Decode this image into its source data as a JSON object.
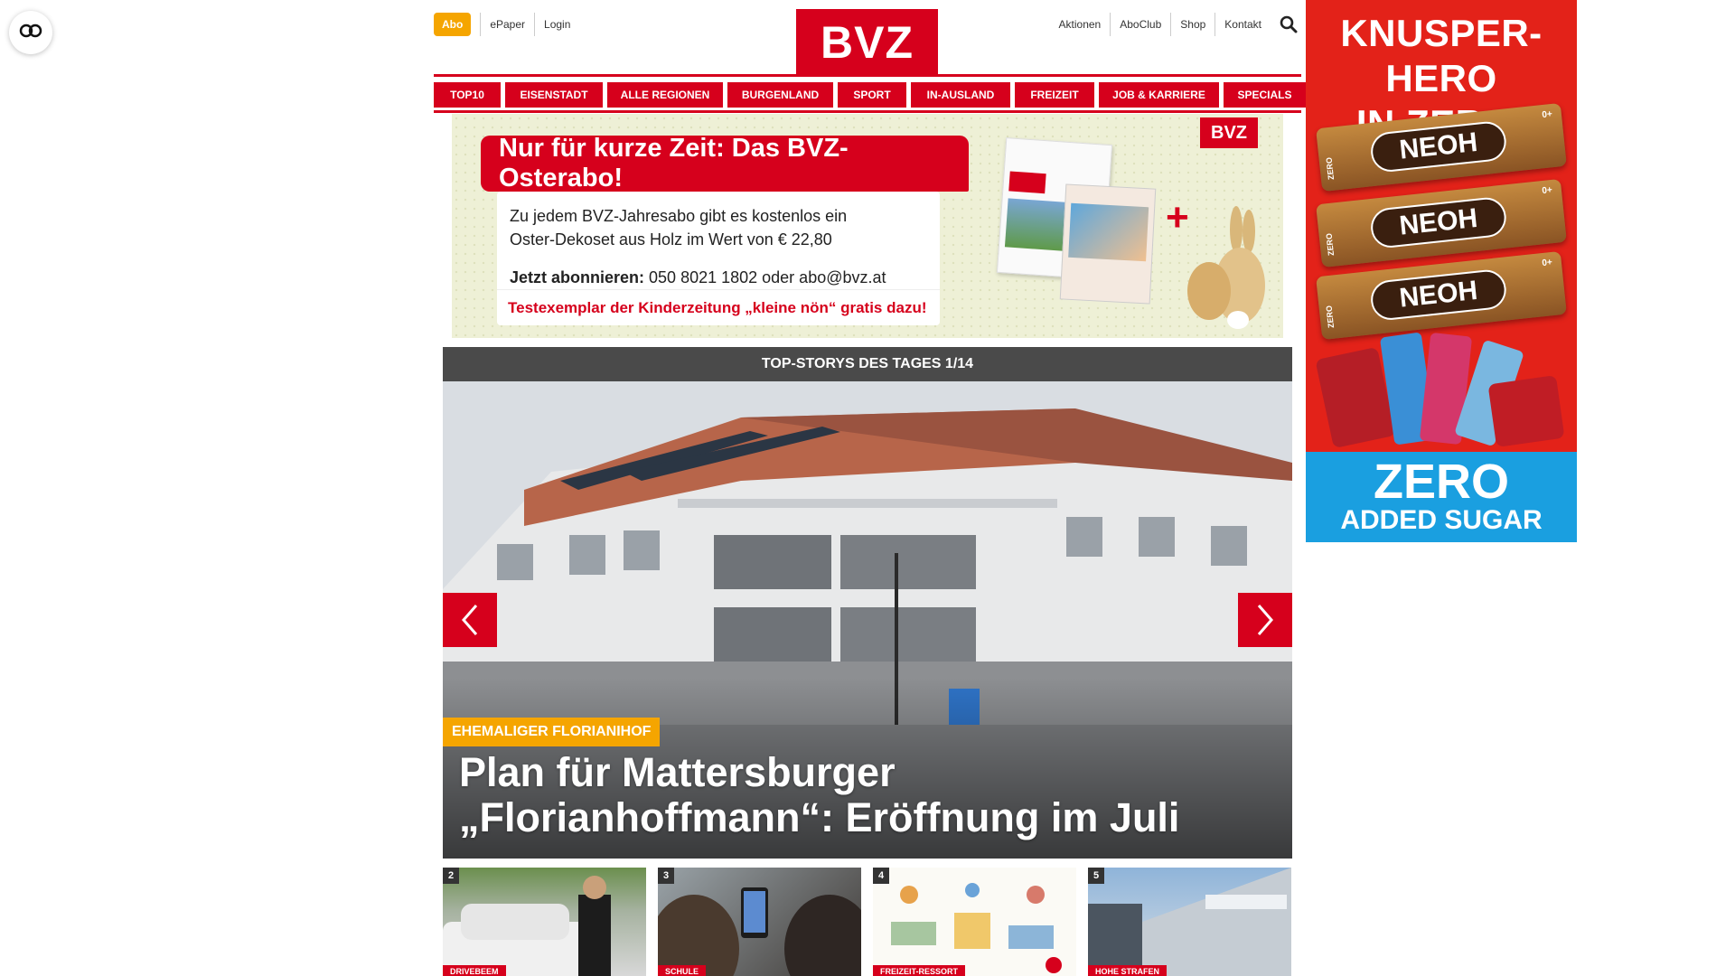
{
  "accessibility": {
    "icon": "accessibility-toggle-icon"
  },
  "header": {
    "abo_label": "Abo",
    "left_links": [
      "ePaper",
      "Login"
    ],
    "logo_text": "BVZ",
    "right_links": [
      "Aktionen",
      "AboClub",
      "Shop",
      "Kontakt"
    ],
    "search_icon": "search-icon"
  },
  "nav": {
    "items": [
      "TOP10",
      "EISENSTADT",
      "ALLE REGIONEN",
      "BURGENLAND",
      "SPORT",
      "IN-AUSLAND",
      "FREIZEIT",
      "JOB & KARRIERE",
      "SPECIALS"
    ]
  },
  "promo": {
    "headline": "Nur für kurze Zeit: Das BVZ-Osterabo!",
    "line1": "Zu jedem BVZ-Jahresabo gibt es kostenlos ein",
    "line2": "Oster-Dekoset aus Holz im Wert von € 22,80",
    "subscribe_label": "Jetzt abonnieren:",
    "subscribe_contact": " 050 8021 1802 oder abo@bvz.at",
    "footer": "Testexemplar der Kinderzeitung „kleine nön“ gratis dazu!",
    "badge": "BVZ",
    "plus": "+"
  },
  "stories": {
    "bar_title": "TOP-STORYS DES TAGES 1/14",
    "hero_kicker": "EHEMALIGER FLORIANIHOF",
    "hero_title": "Plan für Mattersburger „Florianhoffmann“: Eröffnung im Juli",
    "prev_icon": "chevron-left-icon",
    "next_icon": "chevron-right-icon",
    "thumbs": [
      {
        "num": "2",
        "tag": "DRIVEBEEM"
      },
      {
        "num": "3",
        "tag": "SCHULE"
      },
      {
        "num": "4",
        "tag": "FREIZEIT-RESSORT"
      },
      {
        "num": "5",
        "tag": "HOHE STRAFEN"
      }
    ]
  },
  "ad": {
    "title_line1": "KNUSPER-HERO",
    "title_line2": "IN ZERO!",
    "bar_brand": "NEOH",
    "bar_side": "ZERO",
    "bar_age": "0+",
    "bottom_line1": "ZERO",
    "bottom_line2": "ADDED SUGAR",
    "colors": {
      "ad_red": "#e32219",
      "ad_blue": "#1a9fe0"
    }
  },
  "colors": {
    "brand_red": "#d6001c",
    "accent_orange": "#f5a500",
    "bar_gray": "#4a4a4a"
  }
}
